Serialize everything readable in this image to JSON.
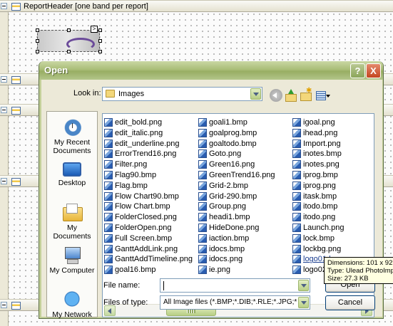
{
  "designer": {
    "bands": [
      {
        "label": "ReportHeader [one band per report]"
      },
      {
        "label": ""
      },
      {
        "label": ""
      },
      {
        "label": ""
      },
      {
        "label": ""
      }
    ]
  },
  "dialog": {
    "title": "Open",
    "help_glyph": "?",
    "close_glyph": "X",
    "look_in_label": "Look in:",
    "look_in_value": "Images",
    "places": [
      {
        "label": "My Recent Documents",
        "icon": "recent-documents-icon"
      },
      {
        "label": "Desktop",
        "icon": "desktop-icon"
      },
      {
        "label": "My Documents",
        "icon": "my-documents-icon"
      },
      {
        "label": "My Computer",
        "icon": "my-computer-icon"
      },
      {
        "label": "My Network",
        "icon": "my-network-icon"
      }
    ],
    "files": {
      "col1": [
        "edit_bold.png",
        "edit_italic.png",
        "edit_underline.png",
        "ErrorTrend16.png",
        "Filter.png",
        "Flag90.bmp",
        "Flag.bmp",
        "Flow Chart90.bmp",
        "Flow Chart.bmp",
        "FolderClosed.png",
        "FolderOpen.png",
        "Full Screen.bmp",
        "GanttAddLink.png",
        "GanttAddTimeline.png",
        "goal16.bmp"
      ],
      "col2": [
        "goali1.bmp",
        "goalprog.bmp",
        "goaltodo.bmp",
        "Goto.png",
        "Green16.png",
        "GreenTrend16.png",
        "Grid-2.bmp",
        "Grid-290.bmp",
        "Group.png",
        "headi1.bmp",
        "HideDone.png",
        "iaction.bmp",
        "idocs.bmp",
        "idocs.png",
        "ie.png"
      ],
      "col3": [
        "igoal.png",
        "ihead.png",
        "Import.png",
        "inotes.bmp",
        "inotes.png",
        "iprog.bmp",
        "iprog.png",
        "itask.bmp",
        "itodo.bmp",
        "itodo.png",
        "Launch.png",
        "lock.bmp",
        "lockbg.png",
        "logo01.bmp",
        "logo02.bmp"
      ]
    },
    "file_name_label": "File name:",
    "file_name_value": "",
    "files_of_type_label": "Files of type:",
    "files_of_type_value": "All Image files (*.BMP;*.DIB;*.RLE;*.JPG;*.JPEG",
    "open_label": "Open",
    "cancel_label": "Cancel"
  },
  "tooltip": {
    "line1": "Dimensions: 101 x 92",
    "line2": "Type: Ulead PhotoImp",
    "line3": "Size: 27.3 KB"
  }
}
